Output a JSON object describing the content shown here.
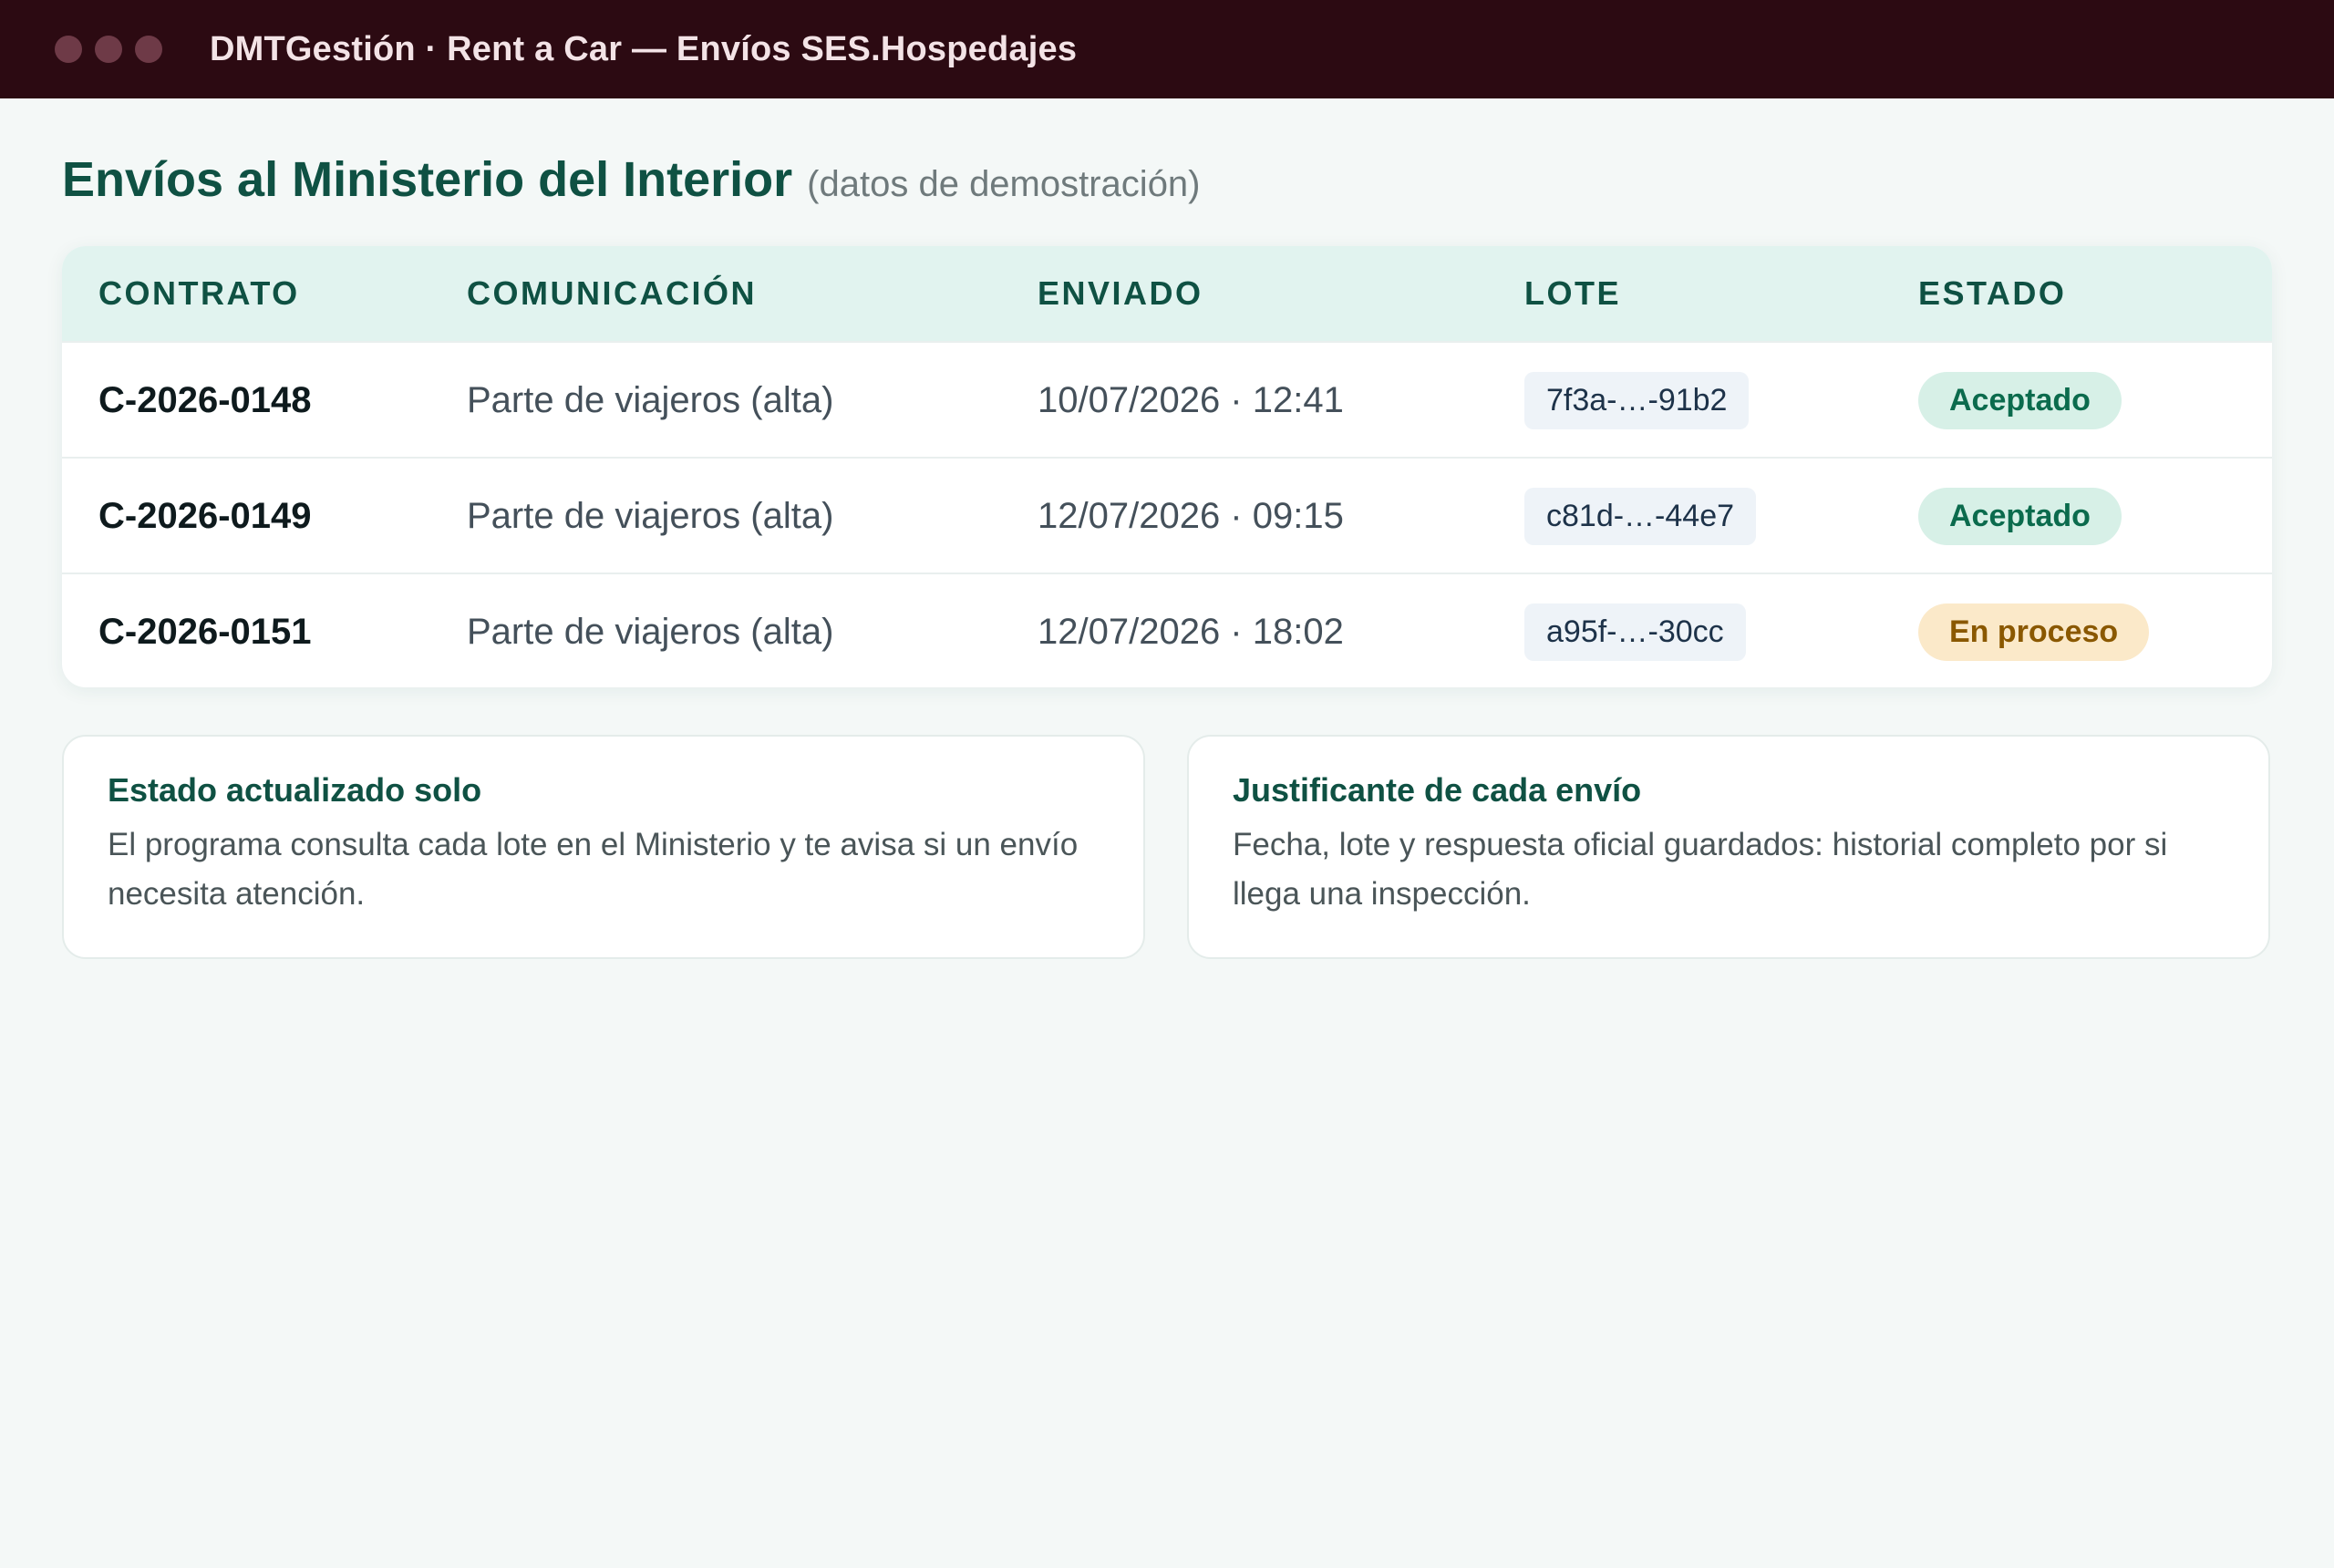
{
  "window": {
    "title": "DMTGestión · Rent a Car — Envíos SES.Hospedajes"
  },
  "page": {
    "title": "Envíos al Ministerio del Interior",
    "subtitle": "(datos de demostración)"
  },
  "table": {
    "columns": [
      "CONTRATO",
      "COMUNICACIÓN",
      "ENVIADO",
      "LOTE",
      "ESTADO"
    ],
    "rows": [
      {
        "contrato": "C-2026-0148",
        "comunicacion": "Parte de viajeros (alta)",
        "enviado": "10/07/2026 · 12:41",
        "lote": "7f3a-…-91b2",
        "estado": "Aceptado"
      },
      {
        "contrato": "C-2026-0149",
        "comunicacion": "Parte de viajeros (alta)",
        "enviado": "12/07/2026 · 09:15",
        "lote": "c81d-…-44e7",
        "estado": "Aceptado"
      },
      {
        "contrato": "C-2026-0151",
        "comunicacion": "Parte de viajeros (alta)",
        "enviado": "12/07/2026 · 18:02",
        "lote": "a95f-…-30cc",
        "estado": "En proceso"
      }
    ]
  },
  "info_cards": [
    {
      "title": "Estado actualizado solo",
      "text": "El programa consulta cada lote en el Ministerio y te avisa si un envío necesita atención."
    },
    {
      "title": "Justificante de cada envío",
      "text": "Fecha, lote y respuesta oficial guardados: historial completo por si llega una inspección."
    }
  ],
  "colors": {
    "titlebar": "#2c0a12",
    "accent": "#0f5143",
    "status_accepted": "#0b6b4d",
    "status_in_process": "#8a5800"
  }
}
